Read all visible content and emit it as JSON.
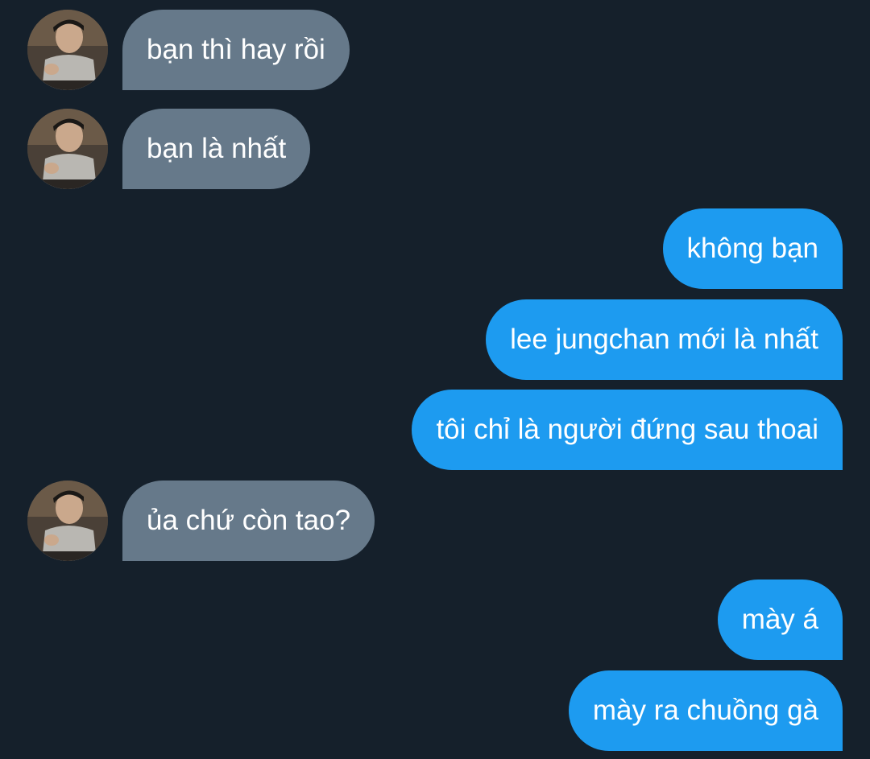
{
  "colors": {
    "background": "#15202b",
    "incoming_bubble": "#66798a",
    "outgoing_bubble": "#1d9bf0",
    "text": "#ffffff"
  },
  "messages": [
    {
      "direction": "incoming",
      "text": "bạn thì hay rồi",
      "avatar": "user-avatar"
    },
    {
      "direction": "incoming",
      "text": "bạn là nhất",
      "avatar": "user-avatar"
    },
    {
      "direction": "outgoing",
      "text": "không bạn"
    },
    {
      "direction": "outgoing",
      "text": "lee jungchan mới là nhất"
    },
    {
      "direction": "outgoing",
      "text": "tôi chỉ là người đứng sau thoai"
    },
    {
      "direction": "incoming",
      "text": "ủa chứ còn tao?",
      "avatar": "user-avatar"
    },
    {
      "direction": "outgoing",
      "text": "mày á"
    },
    {
      "direction": "outgoing",
      "text": "mày ra chuồng gà"
    }
  ]
}
